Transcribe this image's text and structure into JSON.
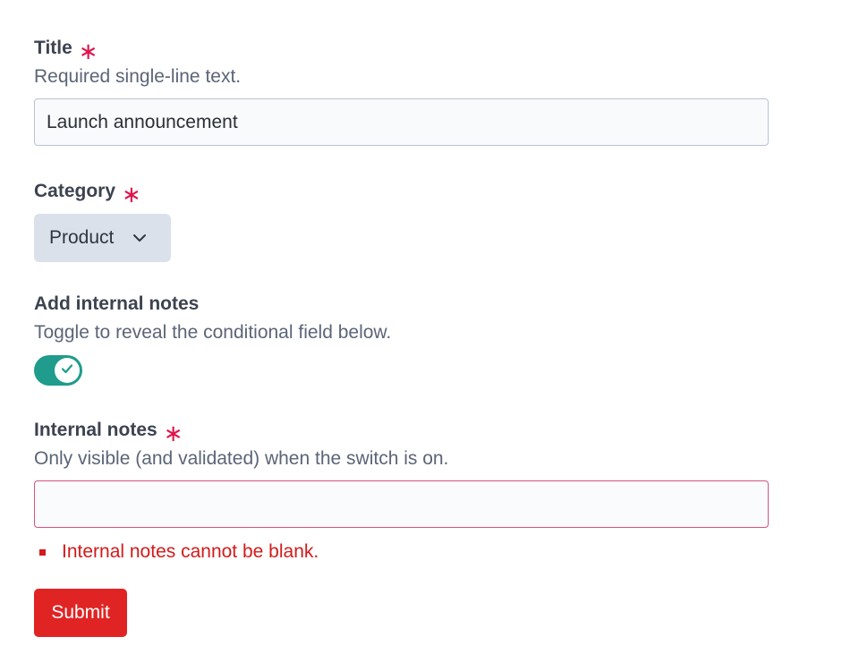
{
  "fields": {
    "title": {
      "label": "Title",
      "required_mark": "∗",
      "hint": "Required single-line text.",
      "value": "Launch announcement"
    },
    "category": {
      "label": "Category",
      "required_mark": "∗",
      "selected": "Product",
      "icon": "chevron-down-icon"
    },
    "internal_notes_toggle": {
      "label": "Add internal notes",
      "hint": "Toggle to reveal the conditional field below.",
      "checked": true,
      "icon": "check-icon",
      "color": "#1f9c8b"
    },
    "internal_notes": {
      "label": "Internal notes",
      "required_mark": "∗",
      "hint": "Only visible (and validated) when the switch is on.",
      "value": "",
      "error": "Internal notes cannot be blank."
    }
  },
  "submit": {
    "label": "Submit"
  },
  "colors": {
    "required": "#e0144c",
    "error": "#d41a1a",
    "submit_bg": "#e02424",
    "toggle_on": "#1f9c8b"
  }
}
